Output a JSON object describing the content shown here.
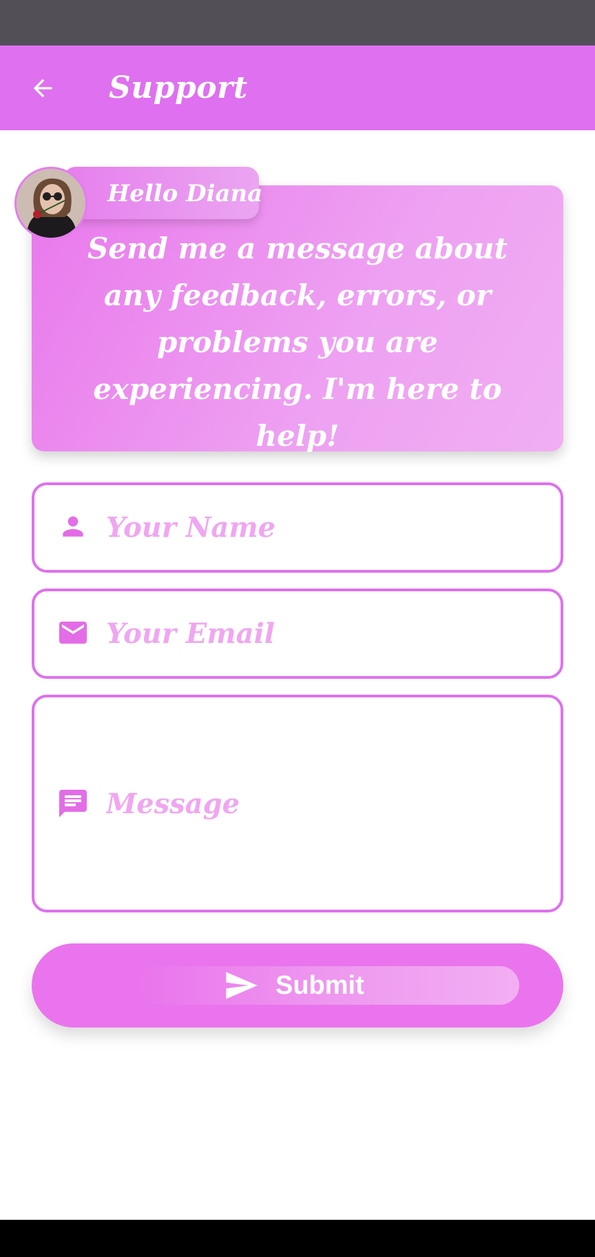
{
  "header": {
    "title": "Support",
    "back_icon": "arrow-left-icon"
  },
  "intro_card": {
    "greeting": "Hello Diana",
    "message": "Send me a message about any feedback, errors, or problems you are experiencing. I'm here to help!",
    "avatar": "avatar-photo"
  },
  "form": {
    "name": {
      "placeholder": "Your Name",
      "value": "",
      "icon": "person-icon"
    },
    "email": {
      "placeholder": "Your Email",
      "value": "",
      "icon": "mail-icon"
    },
    "message": {
      "placeholder": "Message",
      "value": "",
      "icon": "message-icon"
    }
  },
  "submit": {
    "label": "Submit",
    "icon": "send-icon"
  },
  "colors": {
    "accent": "#df70ef",
    "placeholder": "#f0a6f0",
    "status_bar": "#524f57"
  }
}
